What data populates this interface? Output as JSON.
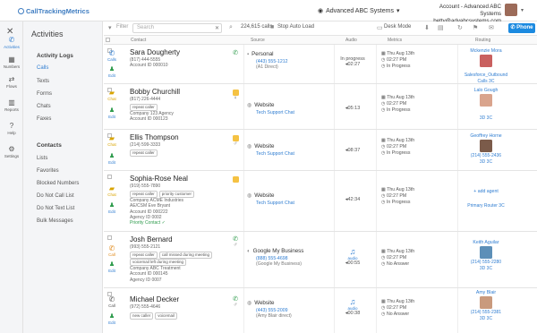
{
  "app": {
    "logo_text": "CallTrackingMetrics"
  },
  "account": {
    "selector_label": "Advanced ABC Systems",
    "title": "Account - Advanced ABC Systems",
    "email": "betty@advabcsystems.com",
    "avatar_color": "#9c6b59"
  },
  "rail": [
    {
      "label": "Activities",
      "icon": "phone-icon",
      "active": true
    },
    {
      "label": "Numbers",
      "icon": "grid-icon",
      "active": false
    },
    {
      "label": "Flows",
      "icon": "flow-icon",
      "active": false
    },
    {
      "label": "Reports",
      "icon": "chart-icon",
      "active": false
    },
    {
      "label": "Help",
      "icon": "question-icon",
      "active": false
    },
    {
      "label": "Settings",
      "icon": "gear-icon",
      "active": false
    }
  ],
  "sidenav": {
    "title": "Activities",
    "section1": "Activity Logs",
    "logs": [
      "Calls",
      "Texts",
      "Forms",
      "Chats",
      "Faxes"
    ],
    "section2": "Contacts",
    "contacts": [
      "Lists",
      "Favorites",
      "Blocked Numbers",
      "Do Not Call List",
      "Do Not Text List",
      "Bulk Messages"
    ]
  },
  "toolbar": {
    "filter": "Filter",
    "search_placeholder": "Search",
    "count": "224,615 calls",
    "stop_auto": "Stop Auto Load",
    "desk_mode": "Desk Mode",
    "phone": "Phone"
  },
  "columns": {
    "contact": "Contact",
    "source": "Source",
    "audio": "Audio",
    "metrics": "Metrics",
    "routing": "Routing"
  },
  "rows": [
    {
      "type": "Calls",
      "name": "Sara Dougherty",
      "phone": "(817) 444-5555",
      "account": "Account ID 000010",
      "source": "Personal",
      "source_num": "(443) 555-1212",
      "source_sub": "(A1 Direct)",
      "audio": "In progress",
      "audio_time": "02:27",
      "date": "Thu Aug 13th",
      "time": "02:27 PM",
      "status": "In Progress",
      "agent": "Mckenzie Mora",
      "agent_sub": "Salesforce_Outbound Calls 3C"
    },
    {
      "type": "Chat",
      "name": "Bobby Churchill",
      "phone": "(817) 226-4444",
      "tags": [
        "repeat caller"
      ],
      "company": "Company 123 Agency",
      "account": "Account ID 000123",
      "source": "Website",
      "source_num": "Tech Support Chat",
      "audio_time": "05:13",
      "date": "Thu Aug 13th",
      "time": "02:27 PM",
      "status": "In Progress",
      "agent": "Lalo Gough",
      "agent_sub": "3D 3C"
    },
    {
      "type": "Chat",
      "name": "Ellis Thompson",
      "phone": "(214) 599-3333",
      "tags": [
        "repeat caller"
      ],
      "source": "Website",
      "source_num": "Tech Support Chat",
      "audio_time": "08:37",
      "date": "Thu Aug 13th",
      "time": "02:27 PM",
      "status": "In Progress",
      "agent": "Geoffrey Horne",
      "agent_sub": "(214) 555-2436",
      "agent_sub2": "3D 3C"
    },
    {
      "type": "Chat",
      "name": "Sophia-Rose Neal",
      "phone": "(919) 555-7890",
      "tags": [
        "repeat caller",
        "priority customer"
      ],
      "company": "Company ACME Industries",
      "extra": [
        "AE/CSM Eve Bryant",
        "Account ID 000222",
        "Agency ID 0002",
        "Priority Contact ✓"
      ],
      "source": "Website",
      "source_num": "Tech Support Chat",
      "audio_time": "42:34",
      "date": "Thu Aug 13th",
      "time": "02:27 PM",
      "status": "In Progress",
      "agent": "+ add agent",
      "agent_sub": "Primary Router 3C"
    },
    {
      "type": "Call",
      "name": "Josh Bernard",
      "phone": "(993) 555-2121",
      "tags": [
        "repeat caller",
        "call missed during meeting",
        "voicemail left during meeting"
      ],
      "company": "Company ABC Treatment",
      "extra": [
        "Account ID 000145",
        "Agency ID 0007"
      ],
      "source": "Google My Business",
      "source_num": "(888) 555-4698",
      "source_sub": "(Google My Business)",
      "audio": "audio",
      "audio_time": "00:55",
      "date": "Thu Aug 13th",
      "time": "02:27 PM",
      "status": "No Answer",
      "agent": "Keith Aguilar",
      "agent_sub": "(214) 555-2280",
      "agent_sub2": "3D 3C"
    },
    {
      "type": "Call",
      "name": "Michael Decker",
      "phone": "(972) 555-4646",
      "tags": [
        "new caller",
        "voicemail"
      ],
      "source": "Website",
      "source_num": "(443) 555-2009",
      "source_sub": "(Amy Blair direct)",
      "audio": "audio",
      "audio_time": "00:38",
      "date": "Thu Aug 13th",
      "time": "02:27 PM",
      "status": "No Answer",
      "agent": "Amy Blair",
      "agent_sub": "(214) 555-2381",
      "agent_sub2": "3D 3C"
    }
  ],
  "colors": {
    "accent": "#2f7dd1",
    "green": "#2e9b4c",
    "chat_yellow": "#f5c243",
    "phone_button": "#1c8ae0"
  }
}
